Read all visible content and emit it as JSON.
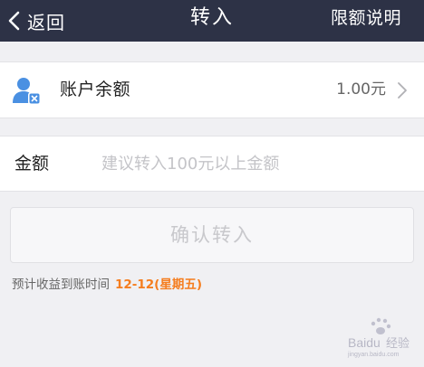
{
  "navbar": {
    "back_label": "返回",
    "title": "转入",
    "right_label": "限额说明"
  },
  "account": {
    "label": "账户余额",
    "value": "1.00元"
  },
  "amount": {
    "label": "金额",
    "placeholder": "建议转入100元以上金额",
    "value": ""
  },
  "confirm": {
    "label": "确认转入"
  },
  "note": {
    "text": "预计收益到账时间",
    "date": "12-12(星期五)"
  },
  "watermark": {
    "text": "Baidu 经验",
    "sub_text": "jingyan.baidu.com"
  },
  "colors": {
    "navbar": "#2d3246",
    "accent": "#f57d1e",
    "icon_blue": "#4a90e2",
    "background": "#f0f0f3"
  }
}
